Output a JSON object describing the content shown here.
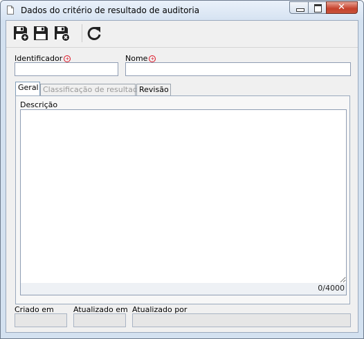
{
  "window": {
    "title": "Dados do critério de resultado de auditoria",
    "icons": [
      "document-icon",
      "minimize-icon",
      "maximize-icon",
      "close-icon"
    ]
  },
  "toolbar": {
    "buttons": [
      {
        "name": "save-and-new",
        "icon": "save-new-icon"
      },
      {
        "name": "save",
        "icon": "save-icon"
      },
      {
        "name": "save-and-close",
        "icon": "save-close-icon"
      },
      {
        "name": "refresh",
        "icon": "refresh-icon"
      }
    ]
  },
  "form": {
    "identificador_label": "Identificador",
    "identificador_value": "",
    "nome_label": "Nome",
    "nome_value": "",
    "required_icon": "required-icon",
    "required_color": "#dd1122"
  },
  "tabs": [
    {
      "label": "Geral",
      "active": true
    },
    {
      "label": "Classificação de resultado",
      "disabled": true
    },
    {
      "label": "Revisão"
    }
  ],
  "geral": {
    "descricao_label": "Descrição",
    "descricao_value": "",
    "counter": "0/4000"
  },
  "footer": {
    "criado_em_label": "Criado em",
    "criado_em_value": "",
    "atualizado_em_label": "Atualizado em",
    "atualizado_em_value": "",
    "atualizado_por_label": "Atualizado por",
    "atualizado_por_value": ""
  },
  "colors": {
    "window_frame": "#d3e1f0",
    "close_button": "#c5412b",
    "input_border": "#8f9db3"
  }
}
